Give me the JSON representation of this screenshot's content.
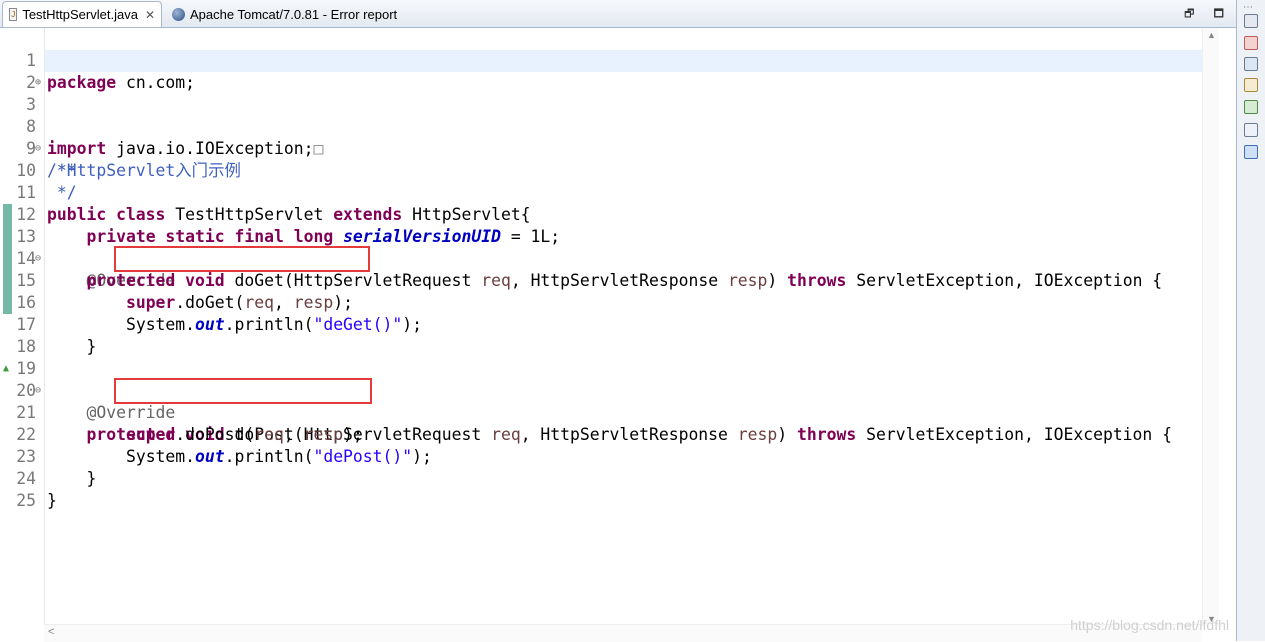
{
  "tabs": [
    {
      "label": "TestHttpServlet.java",
      "close": "✕",
      "icon": "java-file-icon"
    },
    {
      "label": "Apache Tomcat/7.0.81 - Error report",
      "icon": "globe-icon"
    }
  ],
  "window_buttons": {
    "restore": "🗗",
    "maximize": "🗖"
  },
  "editor": {
    "lines": [
      {
        "n": "1"
      },
      {
        "n": "2"
      },
      {
        "n": "3"
      },
      {
        "n": "8"
      },
      {
        "n": "9"
      },
      {
        "n": "10"
      },
      {
        "n": "11"
      },
      {
        "n": "12"
      },
      {
        "n": "13"
      },
      {
        "n": "14"
      },
      {
        "n": "15"
      },
      {
        "n": "16"
      },
      {
        "n": "17"
      },
      {
        "n": "18"
      },
      {
        "n": "19"
      },
      {
        "n": "20"
      },
      {
        "n": "21"
      },
      {
        "n": "22"
      },
      {
        "n": "23"
      },
      {
        "n": "24"
      },
      {
        "n": "25"
      }
    ],
    "code": {
      "l1": {
        "kw": "package",
        "rest": " cn.com;"
      },
      "l3": {
        "kw": "import",
        "rest": " java.io.IOException;",
        "collapsed": "□"
      },
      "l8": "/**",
      "l9": " *HttpServlet入门示例",
      "l10": " */",
      "l11": {
        "kw1": "public class",
        "t1": " TestHttpServlet ",
        "kw2": "extends",
        "t2": " HttpServlet{"
      },
      "l12": {
        "indent": "    ",
        "kw": "private static final long",
        "sp": " ",
        "fld": "serialVersionUID",
        "rest": " = 1L;"
      },
      "l13": "    @Override",
      "l14": {
        "indent": "    ",
        "kw1": "protected void",
        "t1": " doGet(HttpServletRequest ",
        "p1": "req",
        "t2": ", HttpServletResponse ",
        "p2": "resp",
        "t3": ") ",
        "kw2": "throws",
        "t4": " ServletException, IOException {"
      },
      "l15": {
        "indent": "        ",
        "kw": "super",
        "t1": ".doGet(",
        "p1": "req",
        "t2": ", ",
        "p2": "resp",
        "t3": ");"
      },
      "l16": {
        "indent": "        ",
        "t1": "System.",
        "fld": "out",
        "t2": ".println(",
        "str": "\"deGet()\"",
        "t3": ");"
      },
      "l17": "    }",
      "l19": "    @Override",
      "l20": {
        "indent": "    ",
        "kw1": "protected void",
        "t1": " doPost(HttpServletRequest ",
        "p1": "req",
        "t2": ", HttpServletResponse ",
        "p2": "resp",
        "t3": ") ",
        "kw2": "throws",
        "t4": " ServletException, IOException {"
      },
      "l21": {
        "indent": "        ",
        "kw": "super",
        "t1": ".doPost(",
        "p1": "req",
        "t2": ", ",
        "p2": "resp",
        "t3": ");"
      },
      "l22": {
        "indent": "        ",
        "t1": "System.",
        "fld": "out",
        "t2": ".println(",
        "str": "\"dePost()\"",
        "t3": ");"
      },
      "l23": "    }",
      "l24": "}"
    }
  },
  "watermark": "https://blog.csdn.net/lfdfhl",
  "colors": {
    "keyword": "#7f0055",
    "string": "#2a00ff",
    "comment": "#3f5fbf",
    "annotation": "#646464",
    "highlight_box": "#e33b3b",
    "current_line": "#e8f2fe"
  }
}
